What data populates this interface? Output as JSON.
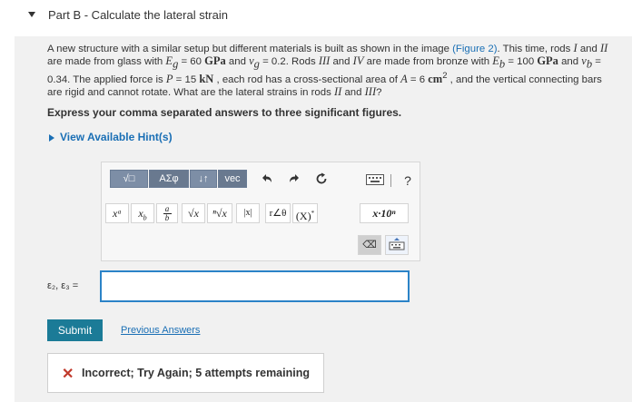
{
  "part": {
    "title": "Part B - Calculate the lateral strain"
  },
  "problem": {
    "text1": "A new structure with a similar setup but different materials is built as shown in the image ",
    "figure_link": "(Figure 2)",
    "text2": ". This time, rods ",
    "rod_I": "I",
    "text3": " and ",
    "rod_II": "II",
    "text4": " are made from glass with ",
    "Eg": "E",
    "Eg_sub": "g",
    "Eg_val": " = 60 ",
    "GPa1": "GPa",
    "text5": " and ",
    "vg": "ν",
    "vg_sub": "g",
    "vg_val": " = 0.2. Rods ",
    "rod_III": "III",
    "text6": " and ",
    "rod_IV": "IV",
    "text7": " are made from bronze with ",
    "Eb": "E",
    "Eb_sub": "b",
    "Eb_val": " = 100 ",
    "GPa2": "GPa",
    "text8": " and ",
    "vb": "ν",
    "vb_sub": "b",
    "text9": " = 0.34. The applied force is ",
    "P": "P",
    "P_val": " = 15 ",
    "kN": "kN",
    "text10": " , each rod has a cross-sectional area of ",
    "A": "A",
    "A_val": " = 6 ",
    "cm": "cm",
    "cm_exp": "2",
    "text11": " , and the vertical connecting bars are rigid and cannot rotate. What are the lateral strains in rods ",
    "rod_II2": "II",
    "text12": " and ",
    "rod_III2": "III",
    "text13": "?"
  },
  "instruction": "Express your comma separated answers to three significant figures.",
  "hints": {
    "label": "View Available Hint(s)"
  },
  "toolbar": {
    "templates_label": "√□",
    "greek_label": "ΑΣφ",
    "arrows_label": "↓↑",
    "vec_label": "vec",
    "undo_icon": "undo-icon",
    "redo_icon": "redo-icon",
    "reset_icon": "reset-icon",
    "keyboard_icon": "keyboard-icon",
    "help_label": "?",
    "sym_power": "xᵃ",
    "sym_sub": "x",
    "sym_sub_b": "b",
    "sym_frac_a": "a",
    "sym_frac_b": "b",
    "sym_sqrt": "√x",
    "sym_nroot": "ⁿ√x",
    "sym_abs": "|x|",
    "sym_angle": "r∠θ",
    "sym_conj": "(X)",
    "sym_conj_sup": "*",
    "sym_sci": "x·10ⁿ",
    "delete_label": "⌫"
  },
  "answer": {
    "label": "ε₂, ε₃ =",
    "value": ""
  },
  "submit": {
    "label": "Submit"
  },
  "previous_answers": {
    "label": "Previous Answers"
  },
  "feedback": {
    "icon": "✕",
    "message": "Incorrect; Try Again; 5 attempts remaining",
    "color": "#c0392b"
  },
  "colors": {
    "link": "#1a6fb5",
    "submit_bg": "#1b7b97",
    "input_border": "#2b83c7",
    "panel_bg": "#f1f1f1"
  }
}
